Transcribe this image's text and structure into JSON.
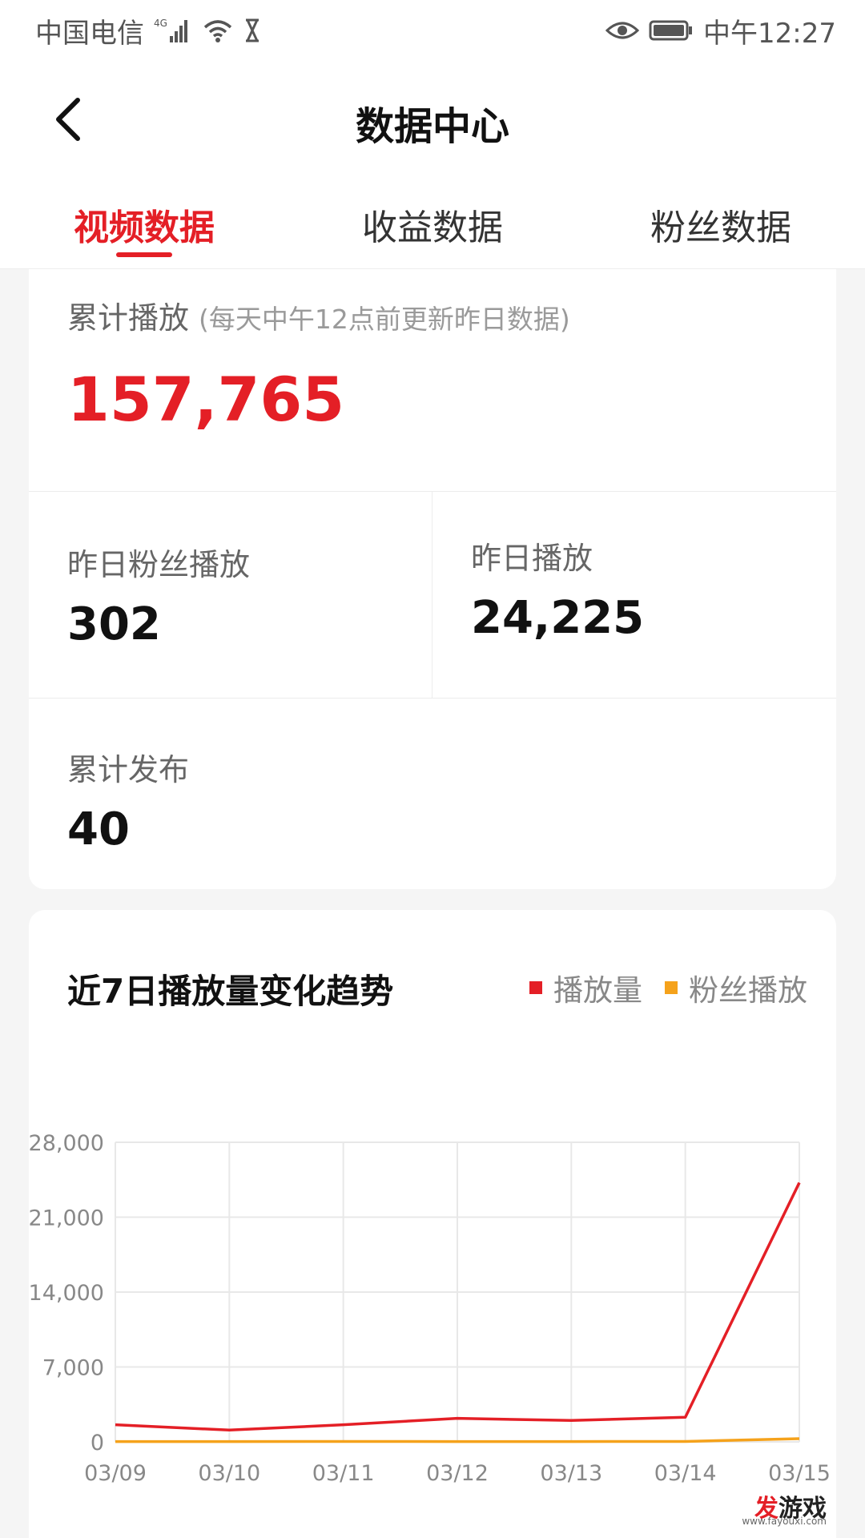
{
  "status_bar": {
    "carrier": "中国电信",
    "network": "4G",
    "time": "中午12:27"
  },
  "nav": {
    "title": "数据中心"
  },
  "tabs": [
    {
      "label": "视频数据",
      "active": true
    },
    {
      "label": "收益数据",
      "active": false
    },
    {
      "label": "粉丝数据",
      "active": false
    }
  ],
  "summary": {
    "total_label": "累计播放",
    "total_note": "(每天中午12点前更新昨日数据)",
    "total_value": "157,765",
    "fans_play_label": "昨日粉丝播放",
    "fans_play_value": "302",
    "yday_play_label": "昨日播放",
    "yday_play_value": "24,225",
    "published_label": "累计发布",
    "published_value": "40"
  },
  "colors": {
    "accent": "#e41f26",
    "series_play": "#e41f26",
    "series_fans": "#f5a21b"
  },
  "chart_data": {
    "type": "line",
    "title": "近7日播放量变化趋势",
    "categories": [
      "03/09",
      "03/10",
      "03/11",
      "03/12",
      "03/13",
      "03/14",
      "03/15"
    ],
    "series": [
      {
        "name": "播放量",
        "color": "#e41f26",
        "values": [
          1600,
          1100,
          1600,
          2200,
          2000,
          2300,
          24225
        ]
      },
      {
        "name": "粉丝播放",
        "color": "#f5a21b",
        "values": [
          30,
          30,
          40,
          30,
          30,
          40,
          302
        ]
      }
    ],
    "ylim": [
      0,
      28000
    ],
    "yticks": [
      0,
      7000,
      14000,
      21000,
      28000
    ],
    "ytick_labels": [
      "0",
      "7,000",
      "14,000",
      "21,000",
      "28,000"
    ],
    "grid": true,
    "legend": "top-right"
  },
  "watermark": {
    "text_hl": "发",
    "text_rest": "游戏",
    "url": "www.fayouxi.com"
  }
}
